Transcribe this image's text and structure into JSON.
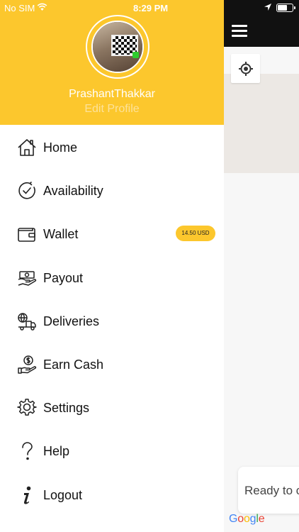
{
  "status_bar": {
    "carrier": "No SIM",
    "time": "8:29 PM"
  },
  "drawer": {
    "user_name": "PrashantThakkar",
    "edit_profile": "Edit Profile",
    "items": [
      {
        "label": "Home",
        "icon": "home-icon"
      },
      {
        "label": "Availability",
        "icon": "clock-check-icon"
      },
      {
        "label": "Wallet",
        "icon": "wallet-icon",
        "badge": "14.50 USD"
      },
      {
        "label": "Payout",
        "icon": "payout-icon"
      },
      {
        "label": "Deliveries",
        "icon": "delivery-truck-icon"
      },
      {
        "label": "Earn Cash",
        "icon": "earn-cash-icon"
      },
      {
        "label": "Settings",
        "icon": "gear-icon"
      },
      {
        "label": "Help",
        "icon": "question-icon"
      },
      {
        "label": "Logout",
        "icon": "info-icon"
      }
    ]
  },
  "map": {
    "status_text": "Ready to c",
    "attribution": "Google"
  },
  "colors": {
    "accent": "#fcc72d",
    "topbar": "#111111"
  }
}
